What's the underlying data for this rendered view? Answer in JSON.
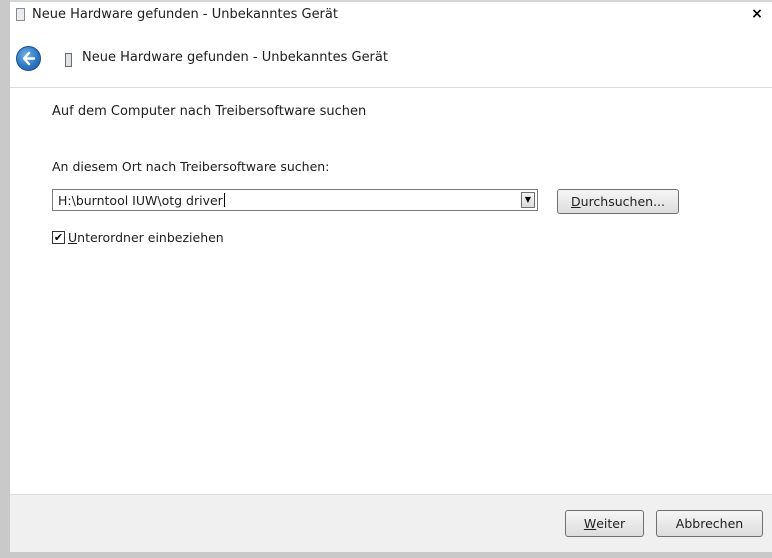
{
  "window": {
    "title": "Neue Hardware gefunden - Unbekanntes Gerät",
    "close_glyph": "×"
  },
  "nav": {
    "back_icon": "back-arrow-icon",
    "device_icon": "device-icon",
    "title": "Neue Hardware gefunden - Unbekanntes Gerät"
  },
  "content": {
    "heading": "Auf dem Computer nach Treibersoftware suchen",
    "search_label": "An diesem Ort nach Treibersoftware suchen:",
    "path_value": "H:\\burntool IUW\\otg driver",
    "browse_button": {
      "accel": "D",
      "rest": "urchsuchen..."
    },
    "include_subfolders": {
      "checked": true,
      "accel": "U",
      "rest": "nterordner einbeziehen"
    }
  },
  "footer": {
    "next_button": {
      "accel": "W",
      "rest": "eiter"
    },
    "cancel_button": "Abbrechen"
  },
  "colors": {
    "window_bg": "#ffffff",
    "footer_bg": "#f0f0f0",
    "back_button": "#2f79c4"
  }
}
